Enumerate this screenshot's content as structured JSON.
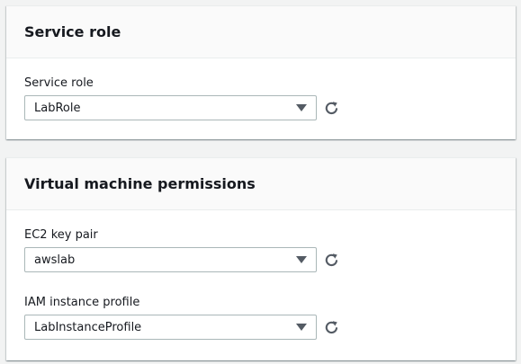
{
  "service_role_panel": {
    "title": "Service role",
    "fields": [
      {
        "label": "Service role",
        "value": "LabRole"
      }
    ]
  },
  "vm_permissions_panel": {
    "title": "Virtual machine permissions",
    "fields": [
      {
        "label": "EC2 key pair",
        "value": "awslab"
      },
      {
        "label": "IAM instance profile",
        "value": "LabInstanceProfile"
      }
    ]
  },
  "icons": {
    "dropdown": "caret-down-icon",
    "refresh": "refresh-icon"
  },
  "colors": {
    "background": "#f2f3f3",
    "panel_header": "#fafafa",
    "select_border": "#aab7b8",
    "icon": "#545b64"
  }
}
